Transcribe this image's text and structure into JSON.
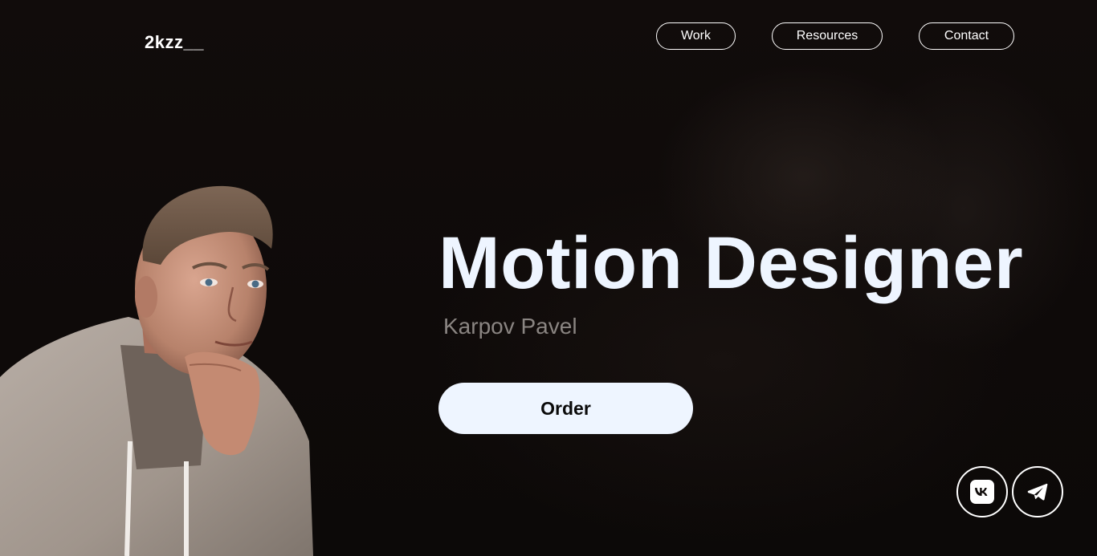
{
  "header": {
    "logo": "2kzz__",
    "nav": [
      {
        "label": "Work"
      },
      {
        "label": "Resources"
      },
      {
        "label": "Contact"
      }
    ]
  },
  "hero": {
    "title": "Motion Designer",
    "subtitle": "Karpov Pavel",
    "order_label": "Order"
  },
  "social": {
    "icons": [
      "vk-icon",
      "telegram-icon"
    ]
  },
  "colors": {
    "background": "#0f0b0a",
    "accent": "#eef5ff",
    "subtitle": "#8a8582"
  }
}
